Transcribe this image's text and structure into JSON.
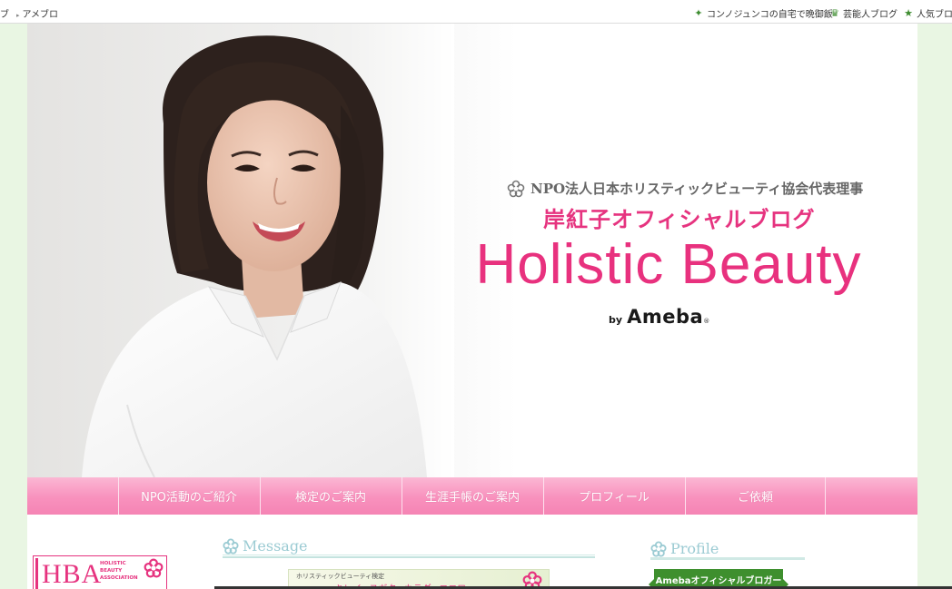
{
  "topbar": {
    "left_links": [
      "ブ",
      "アメブロ"
    ],
    "right_links": [
      {
        "icon": "sparkle-icon",
        "label": "コンノジュンコの自宅で晩御飯"
      },
      {
        "icon": "crown-icon",
        "label": "芸能人ブログ"
      },
      {
        "icon": "star-icon",
        "label": "人気ブロ"
      }
    ]
  },
  "header": {
    "org_line": "NPO法人日本ホリスティックビューティ協会代表理事",
    "blog_subtitle": "岸紅子オフィシャルブログ",
    "blog_title": "Holistic Beauty",
    "by": "by",
    "brand": "Ameba",
    "reg_mark": "®"
  },
  "nav": {
    "items": [
      "NPO活動のご紹介",
      "検定のご案内",
      "生涯手帳のご案内",
      "プロフィール",
      "ご依頼"
    ]
  },
  "sidebar_left": {
    "logo_text": "HBA",
    "logo_small": [
      "HOLISTIC",
      "BEAUTY",
      "ASSOCIATION"
    ]
  },
  "main": {
    "message_heading": "Message",
    "banner_small": "ホリスティックビューティ検定",
    "banner_text": "キレイ×スガタ×カラダ×ココロ"
  },
  "sidebar_right": {
    "profile_heading": "Profile",
    "ameba_badge": "Amebaオフィシャルブロガー"
  },
  "colors": {
    "accent_pink": "#e6337f",
    "nav_pink": "#f891bd",
    "ameba_green": "#3e8f2e",
    "page_bg": "#e9f6e3",
    "heading_teal": "#9bcbd3"
  }
}
